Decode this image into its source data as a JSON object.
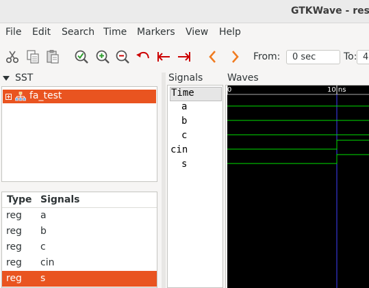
{
  "window": {
    "title": "GTKWave - resul"
  },
  "menu": {
    "items": [
      "File",
      "Edit",
      "Search",
      "Time",
      "Markers",
      "View",
      "Help"
    ]
  },
  "toolbar": {
    "icons": [
      "cut-icon",
      "copy-icon",
      "paste-icon",
      "zoom-fit-icon",
      "zoom-in-icon",
      "zoom-out-icon",
      "undo-zoom-icon",
      "zoom-to-start-icon",
      "zoom-to-end-icon",
      "page-left-icon",
      "page-right-icon"
    ],
    "from_label": "From:",
    "from_value": "0 sec",
    "to_label": "To:",
    "to_value": "4"
  },
  "sst": {
    "header": "SST",
    "tree": [
      {
        "label": "fa_test",
        "selected": true
      }
    ]
  },
  "signal_table": {
    "headers": {
      "type": "Type",
      "signals": "Signals"
    },
    "rows": [
      {
        "type": "reg",
        "name": "a",
        "selected": false
      },
      {
        "type": "reg",
        "name": "b",
        "selected": false
      },
      {
        "type": "reg",
        "name": "c",
        "selected": false
      },
      {
        "type": "reg",
        "name": "cin",
        "selected": false
      },
      {
        "type": "reg",
        "name": "s",
        "selected": true
      }
    ]
  },
  "signals_pane": {
    "header": "Signals",
    "time_label": "Time",
    "names": [
      "a",
      "b",
      "c",
      "cin",
      "s"
    ]
  },
  "waves_pane": {
    "header": "Waves",
    "time_ruler": {
      "start_label": "0",
      "marker_label": "10 ns"
    },
    "waveform_color": "#00e000",
    "marker_color": "#4040ff",
    "traces": [
      {
        "signal": "a",
        "levels": [
          {
            "t_ns": 0,
            "value": 0
          }
        ]
      },
      {
        "signal": "b",
        "levels": [
          {
            "t_ns": 0,
            "value": 0
          }
        ]
      },
      {
        "signal": "c",
        "levels": [
          {
            "t_ns": 0,
            "value": 0
          }
        ]
      },
      {
        "signal": "cin",
        "levels": [
          {
            "t_ns": 0,
            "value": 0
          },
          {
            "t_ns": 10,
            "value": 1
          }
        ]
      },
      {
        "signal": "s",
        "levels": [
          {
            "t_ns": 0,
            "value": 0
          },
          {
            "t_ns": 10,
            "value": 1
          }
        ]
      }
    ]
  },
  "colors": {
    "selection": "#e95420",
    "wave_background": "#000000"
  }
}
